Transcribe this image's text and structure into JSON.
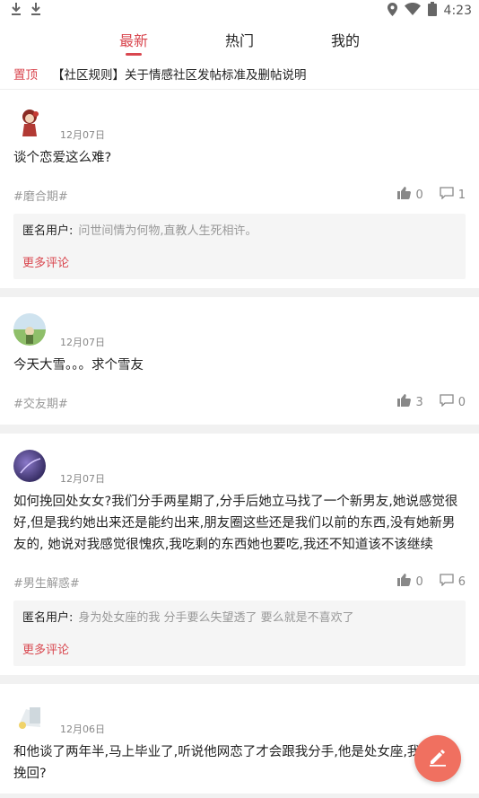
{
  "status_bar": {
    "time": "4:23",
    "icons": [
      "download-icon",
      "download-icon",
      "location-icon",
      "wifi-icon",
      "battery-icon"
    ]
  },
  "tabs": [
    {
      "label": "最新",
      "active": true
    },
    {
      "label": "热门",
      "active": false
    },
    {
      "label": "我的",
      "active": false
    }
  ],
  "pinned": {
    "tag": "置顶",
    "title": "【社区规则】关于情感社区发帖标准及删帖说明"
  },
  "posts": [
    {
      "date": "12月07日",
      "content": "谈个恋爱这么难?",
      "topic": "#磨合期#",
      "likes": "0",
      "comments_count": "1",
      "comment_user": "匿名用户:",
      "comment_text": "问世间情为何物,直教人生死相许。",
      "more": "更多评论"
    },
    {
      "date": "12月07日",
      "content": "今天大雪。。。求个雪友",
      "topic": "#交友期#",
      "likes": "3",
      "comments_count": "0"
    },
    {
      "date": "12月07日",
      "content": "如何挽回处女女?我们分手两星期了,分手后她立马找了一个新男友,她说感觉很好,但是我约她出来还是能约出来,朋友圈这些还是我们以前的东西,没有她新男友的, 她说对我感觉很愧疚,我吃剩的东西她也要吃,我还不知道该不该继续",
      "topic": "#男生解惑#",
      "likes": "0",
      "comments_count": "6",
      "comment_user": "匿名用户:",
      "comment_text": "身为处女座的我 分手要么失望透了 要么就是不喜欢了",
      "more": "更多评论"
    },
    {
      "date": "12月06日",
      "content": "和他谈了两年半,马上毕业了,听说他网恋了才会跟我分手,他是处女座,我该怎么挽回?"
    }
  ],
  "colors": {
    "accent": "#d9474f",
    "fab": "#f07060"
  }
}
